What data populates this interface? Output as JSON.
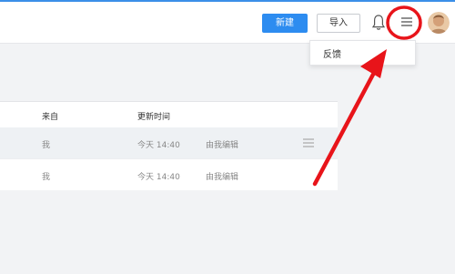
{
  "header": {
    "new_label": "新建",
    "import_label": "导入",
    "accent": "#2d8cf0",
    "icons": [
      "bell-icon",
      "menu-icon",
      "avatar"
    ]
  },
  "dropdown": {
    "items": [
      {
        "label": "反馈"
      }
    ]
  },
  "table": {
    "columns": [
      "来自",
      "更新时间"
    ],
    "rows": [
      {
        "from": "我",
        "updated": "今天 14:40",
        "editor": "由我编辑",
        "has_menu": true
      },
      {
        "from": "我",
        "updated": "今天 14:40",
        "editor": "由我编辑",
        "has_menu": false
      }
    ]
  },
  "annotation": {
    "color": "#e8141a",
    "shapes": [
      "circle-highlight",
      "arrow"
    ]
  }
}
